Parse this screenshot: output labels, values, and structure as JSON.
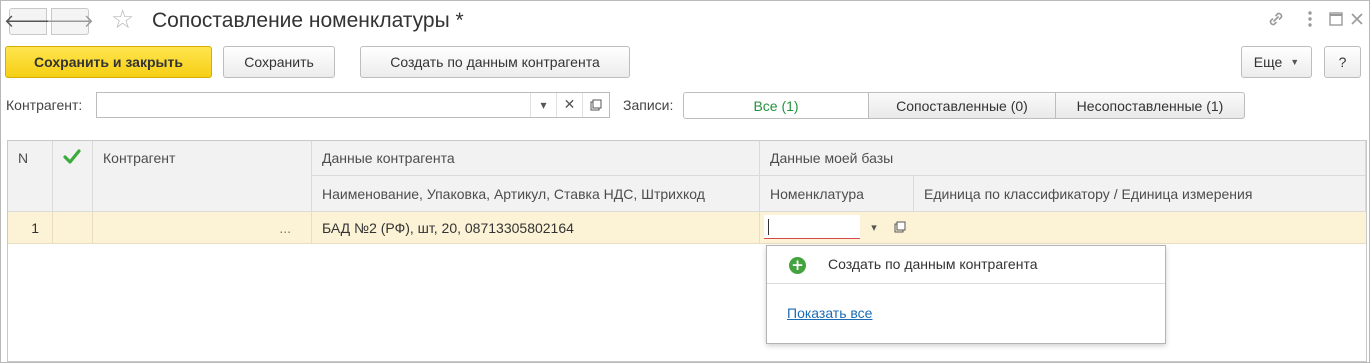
{
  "window": {
    "title": "Сопоставление номенклатуры *"
  },
  "toolbar": {
    "save_close_label": "Сохранить и закрыть",
    "save_label": "Сохранить",
    "create_label": "Создать по данным контрагента",
    "more_label": "Еще",
    "help_label": "?"
  },
  "filter": {
    "counterparty_label": "Контрагент:",
    "counterparty_value": "",
    "records_label": "Записи:",
    "segments": [
      "Все (1)",
      "Сопоставленные (0)",
      "Несопоставленные (1)"
    ],
    "active_segment": 0
  },
  "table": {
    "headers": {
      "n": "N",
      "counterparty": "Контрагент",
      "counterparty_data": "Данные контрагента",
      "my_base_data": "Данные моей базы",
      "item_attrs": "Наименование, Упаковка, Артикул, Ставка НДС, Штрихкод",
      "nomenclature": "Номенклатура",
      "unit": "Единица по классификатору / Единица измерения"
    },
    "rows": [
      {
        "n": "1",
        "counterparty": "...",
        "item_attrs": "БАД №2 (РФ), шт, 20, 08713305802164",
        "nomenclature": "",
        "unit": ""
      }
    ]
  },
  "dropdown": {
    "create_label": "Создать по данным контрагента",
    "show_all_label": "Показать все"
  },
  "colors": {
    "accent_yellow": "#f6cf14",
    "selected_row": "#fcf3d7",
    "check_green": "#3cab3c",
    "active_segment_text": "#23933b",
    "link_blue": "#1c6cb5"
  },
  "icons": {
    "back": "arrow-left-icon",
    "forward": "arrow-right-icon",
    "favorite": "star-icon",
    "link": "link-icon",
    "menu": "kebab-menu-icon",
    "maximize": "maximize-icon",
    "close": "close-icon",
    "check": "checkmark-icon",
    "plus": "plus-circle-icon"
  }
}
